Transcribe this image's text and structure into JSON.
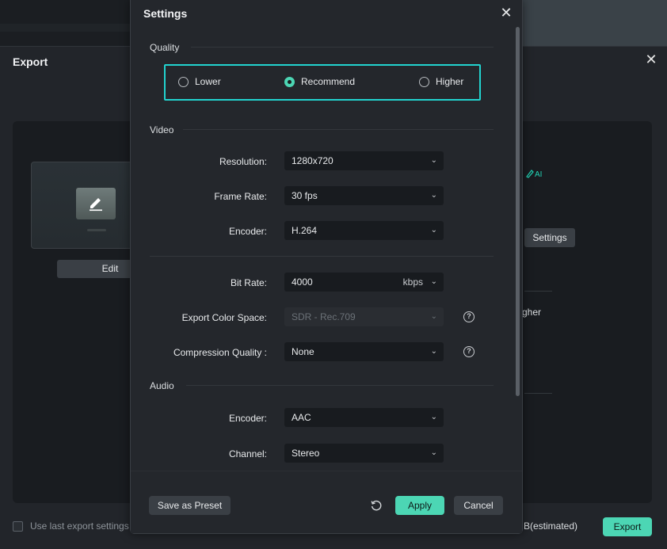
{
  "export_dialog": {
    "title": "Export",
    "edit_label": "Edit",
    "settings_label": "Settings",
    "higher_partial": "gher",
    "use_last_label": "Use last export settings",
    "estimated_label": "B(estimated)",
    "export_label": "Export",
    "ai_label": "AI"
  },
  "settings": {
    "title": "Settings",
    "quality": {
      "section": "Quality",
      "options": [
        "Lower",
        "Recommend",
        "Higher"
      ],
      "selected": "Recommend"
    },
    "video": {
      "section": "Video",
      "resolution_label": "Resolution:",
      "resolution_value": "1280x720",
      "frame_rate_label": "Frame Rate:",
      "frame_rate_value": "30 fps",
      "encoder_label": "Encoder:",
      "encoder_value": "H.264",
      "bit_rate_label": "Bit Rate:",
      "bit_rate_value": "4000",
      "bit_rate_unit": "kbps",
      "color_space_label": "Export Color Space:",
      "color_space_value": "SDR - Rec.709",
      "compression_label": "Compression Quality :",
      "compression_value": "None"
    },
    "audio": {
      "section": "Audio",
      "encoder_label": "Encoder:",
      "encoder_value": "AAC",
      "channel_label": "Channel:",
      "channel_value": "Stereo"
    },
    "footer": {
      "save_preset": "Save as Preset",
      "apply": "Apply",
      "cancel": "Cancel"
    }
  },
  "colors": {
    "accent": "#4cd6b4",
    "highlight_border": "#22d3cf"
  }
}
